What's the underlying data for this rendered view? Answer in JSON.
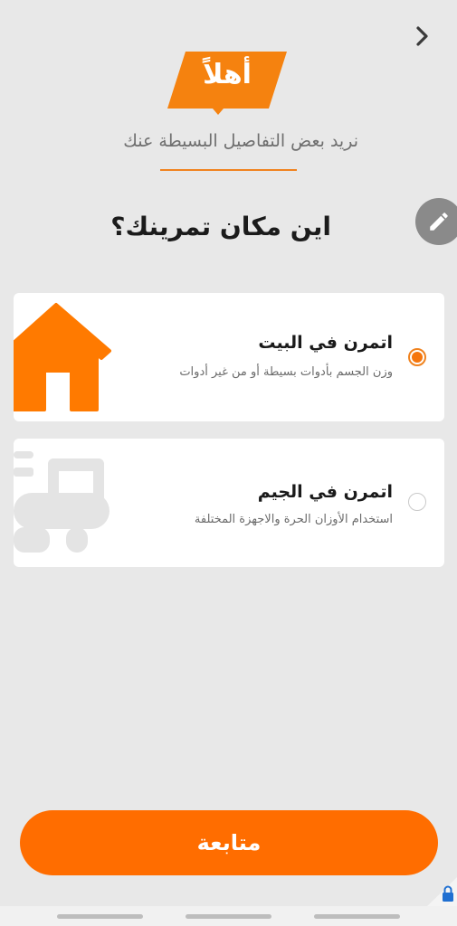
{
  "header": {
    "badge_text": "أهلاً",
    "subtitle": "نريد بعض التفاصيل البسيطة عنك"
  },
  "question": "اين مكان تمرينك؟",
  "options": [
    {
      "title": "اتمرن في البيت",
      "description": "وزن الجسم بأدوات بسيطة أو من غير أدوات",
      "selected": true,
      "icon": "house-icon"
    },
    {
      "title": "اتمرن في الجيم",
      "description": "استخدام الأوزان الحرة والاجهزة المختلفة",
      "selected": false,
      "icon": "gym-machine-icon"
    }
  ],
  "continue_label": "متابعة",
  "icons": {
    "back": "chevron-right-icon",
    "edit": "pencil-icon",
    "lock": "lock-icon"
  },
  "colors": {
    "accent": "#ff6d00",
    "badge": "#f5820f",
    "background": "#e8e8e8",
    "card": "#ffffff"
  }
}
